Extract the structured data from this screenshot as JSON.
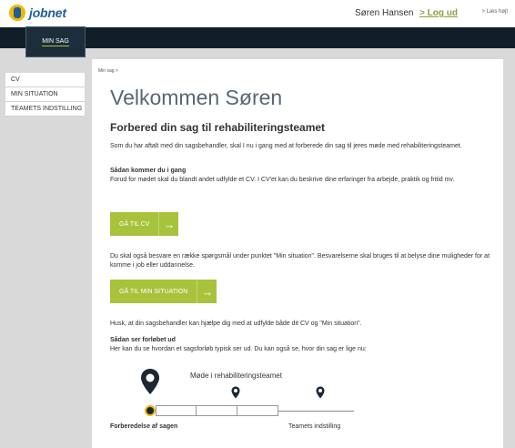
{
  "header": {
    "logo_text": "jobnet",
    "user_name": "Søren Hansen",
    "logout_label": "> Log ud",
    "read_aloud_label": "> Læs højt"
  },
  "nav": {
    "tab_label": "MIN SAG"
  },
  "sidebar": {
    "items": [
      {
        "label": "CV"
      },
      {
        "label": "MIN SITUATION"
      },
      {
        "label": "TEAMETS INDSTILLING"
      }
    ]
  },
  "main": {
    "breadcrumb": "Min sag >",
    "title": "Velkommen Søren",
    "subtitle": "Forbered din sag til rehabiliteringsteamet",
    "intro": "Som du har aftalt med din sagsbehandler, skal I nu i gang med at forberede din sag til jeres møde med rehabiliteringsteamet.",
    "how_heading": "Sådan kommer du i gang",
    "how_text": "Forud for mødet skal du blandt andet udfylde et CV. I CV'et kan du beskrive dine erfaringer fra arbejde, praktik og fritid mv.",
    "cv_button": "GÅ TIL CV",
    "situation_text": "Du skal også besvare en række spørgsmål under punktet \"Min situation\". Besvarelserne skal bruges til at belyse dine muligheder for at komme i job eller uddannelse.",
    "situation_button": "GÅ TIL MIN SITUATION",
    "help_text": "Husk, at din sagsbehandler kan hjælpe dig med at udfylde både dit CV og \"Min situation\".",
    "process_heading": "Sådan ser forløbet ud",
    "process_text": "Her kan du se hvordan et sagsforløb typisk ser ud.  Du kan også se, hvor din sag er lige nu:"
  },
  "timeline": {
    "meeting_label": "Møde i rehabiliteringsteamet",
    "prep_label": "Forberedelse af sagen",
    "team_label": "Teamets indstilling"
  },
  "colors": {
    "accent_green": "#a8c23b",
    "nav_dark": "#101e2a",
    "logo_yellow": "#f2b705",
    "logo_blue": "#1e5e9a"
  }
}
